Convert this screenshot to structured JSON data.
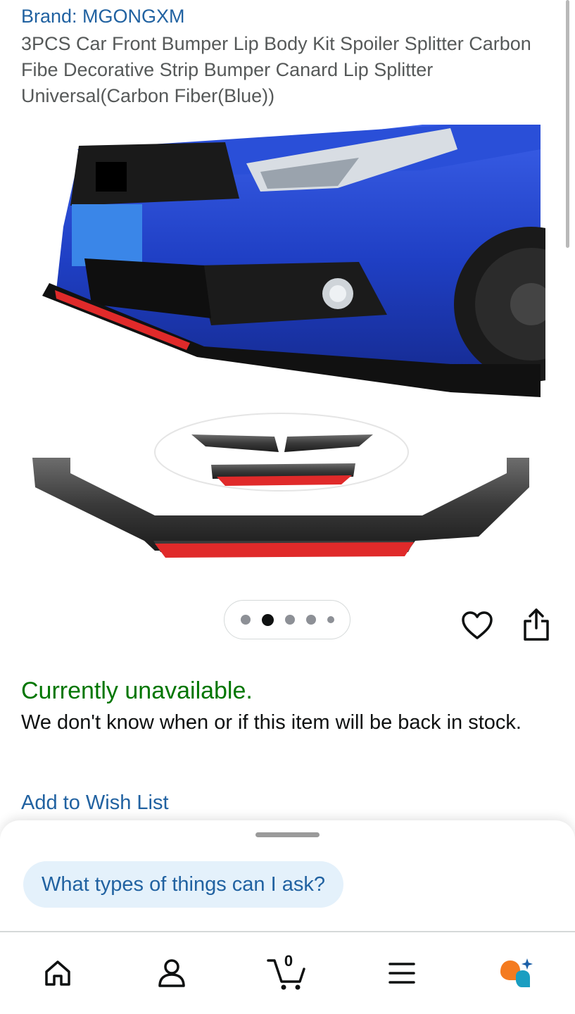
{
  "product": {
    "brand": "Brand: MGONGXM",
    "title": "3PCS Car Front Bumper Lip Body Kit Spoiler Splitter Carbon Fibe Decorative Strip Bumper Canard Lip Splitter Universal(Carbon Fiber(Blue))"
  },
  "gallery": {
    "image_count": 5,
    "active_index": 1
  },
  "actions": {
    "favorite_icon": "heart-icon",
    "share_icon": "share-icon"
  },
  "availability": {
    "status": "Currently unavailable.",
    "note": "We don't know when or if this item will be back in stock.",
    "status_color": "#007600"
  },
  "wishlist": {
    "label": "Add to Wish List"
  },
  "assistant": {
    "prompt_chip": "What types of things can I ask?"
  },
  "bottom_nav": {
    "items": [
      {
        "icon": "home-icon"
      },
      {
        "icon": "account-icon"
      },
      {
        "icon": "cart-icon",
        "count": "0"
      },
      {
        "icon": "menu-icon"
      },
      {
        "icon": "rufus-assistant-icon"
      }
    ]
  },
  "colors": {
    "link": "#2162a1",
    "success": "#007600",
    "chip_bg": "#e4f1fb",
    "rufus_orange": "#f47b20",
    "rufus_teal": "#1a9ec1"
  }
}
